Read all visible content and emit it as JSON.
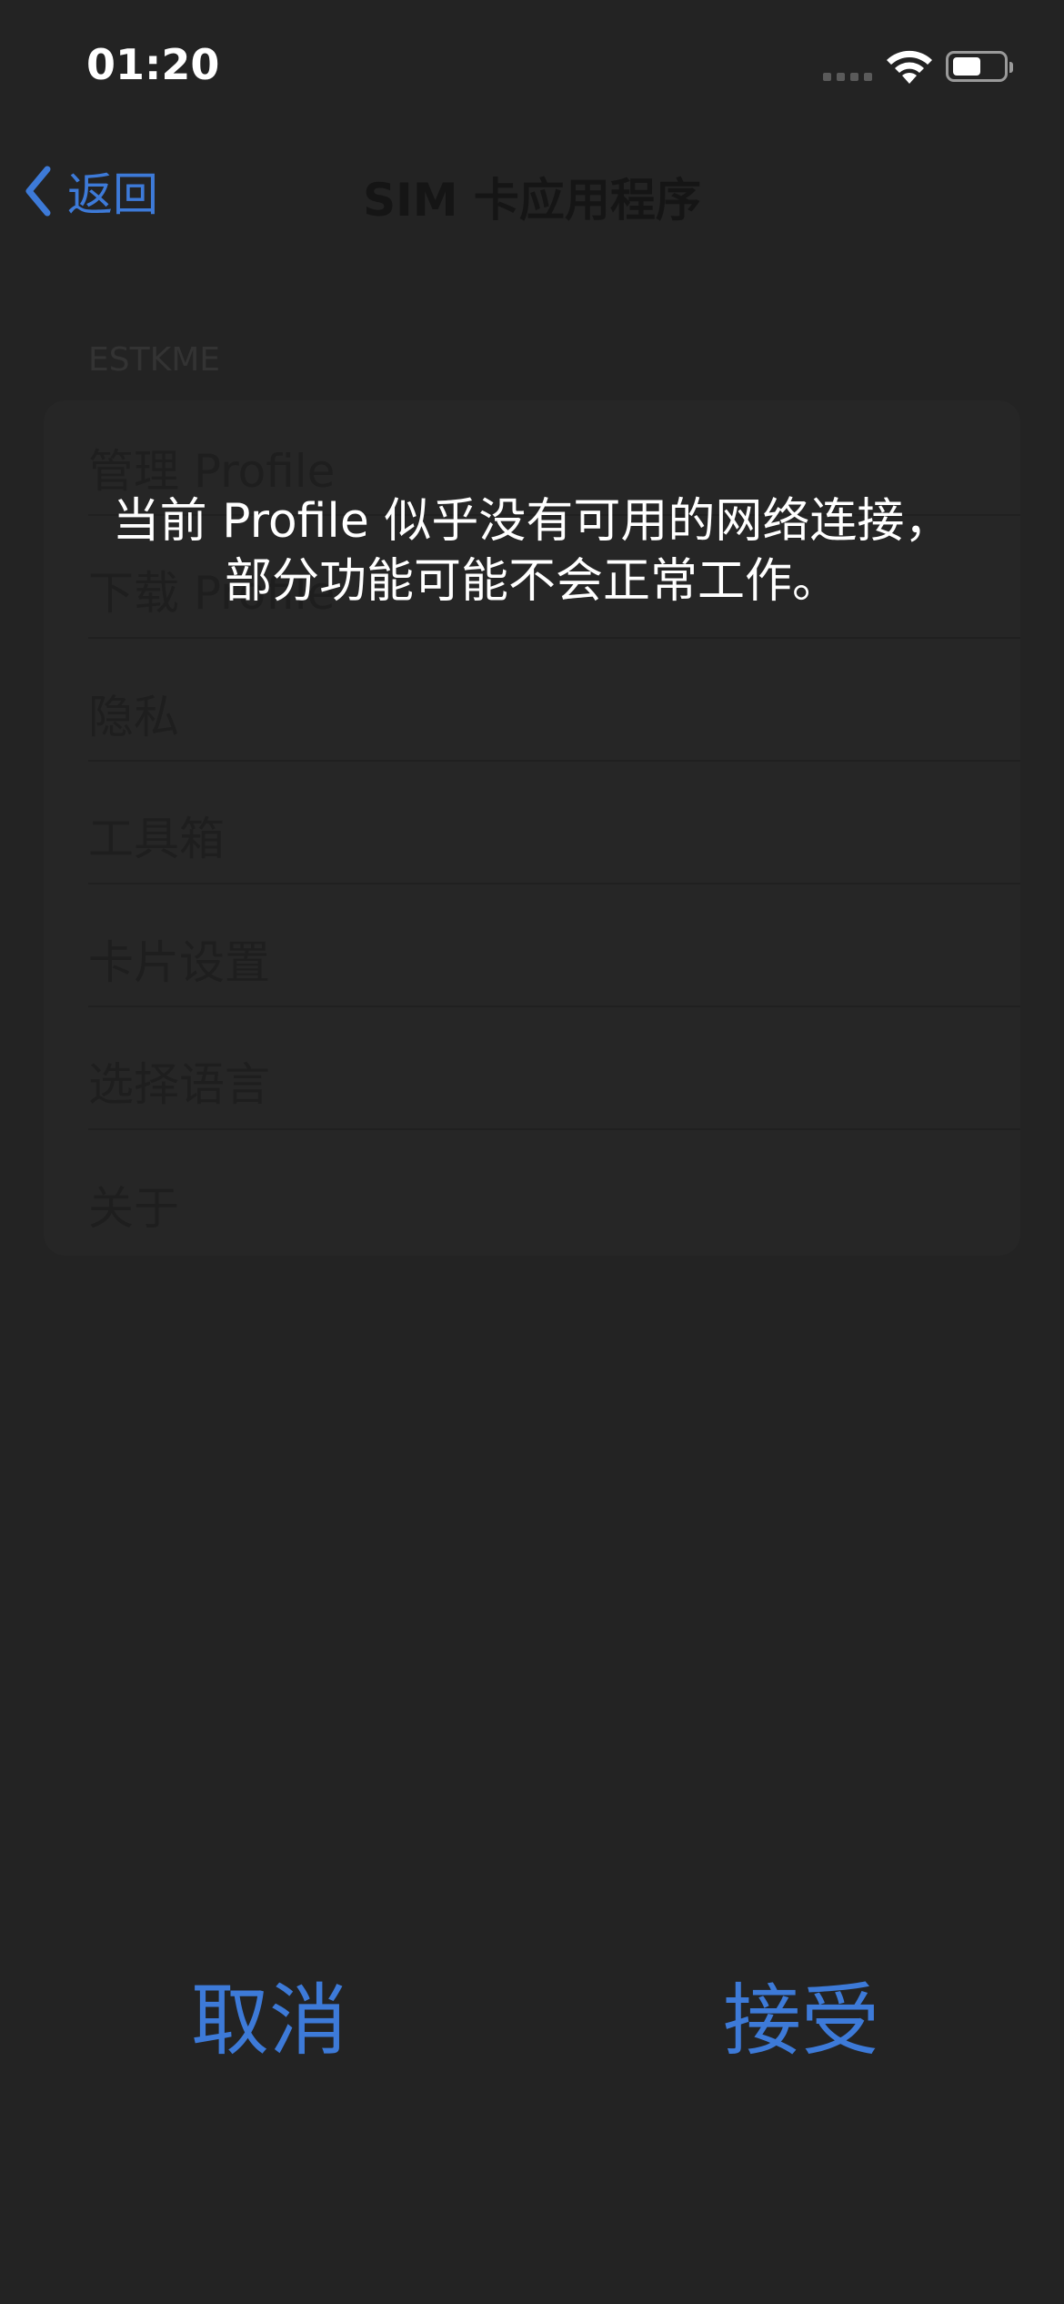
{
  "status_bar": {
    "time": "01:20"
  },
  "nav": {
    "back_label": "返回",
    "title": "SIM 卡应用程序"
  },
  "list": {
    "section_header": "ESTKME",
    "items": [
      "管理 Profile",
      "下载 Profile",
      "隐私",
      "工具箱",
      "卡片设置",
      "选择语言",
      "关于"
    ]
  },
  "dialog": {
    "message_line1": "当前 Profile 似乎没有可用的网络连接，",
    "message_line2": "部分功能可能不会正常工作。",
    "cancel_label": "取消",
    "accept_label": "接受"
  },
  "colors": {
    "accent": "#3d7ad8",
    "background": "#232323",
    "text": "#ffffff"
  },
  "icons": [
    "wifi-icon",
    "battery-icon",
    "signal-icon",
    "chevron-left-icon"
  ]
}
